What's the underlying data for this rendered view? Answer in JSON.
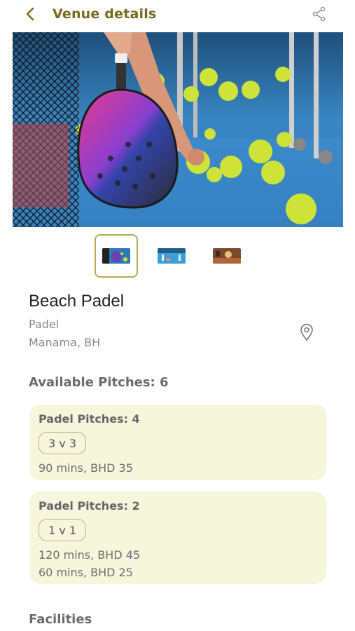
{
  "header": {
    "title": "Venue details",
    "back_icon": "chevron-left-icon",
    "share_icon": "share-icon"
  },
  "gallery": {
    "thumbnails": [
      "thumbnail-1",
      "thumbnail-2",
      "thumbnail-3"
    ],
    "selected_index": 0
  },
  "venue": {
    "name": "Beach Padel",
    "sport": "Padel",
    "location": "Manama, BH"
  },
  "available_pitches": "Available Pitches: 6",
  "pitch_groups": [
    {
      "title": "Padel Pitches: 4",
      "format": "3 v 3",
      "prices": [
        "90 mins, BHD 35"
      ]
    },
    {
      "title": "Padel Pitches: 2",
      "format": "1 v 1",
      "prices": [
        "120 mins, BHD 45",
        "60 mins, BHD 25"
      ]
    }
  ],
  "facilities_heading": "Facilities",
  "colors": {
    "accent": "#7a6a1d",
    "card_bg": "#f6f6dd",
    "thumb_border": "#b9a955"
  }
}
